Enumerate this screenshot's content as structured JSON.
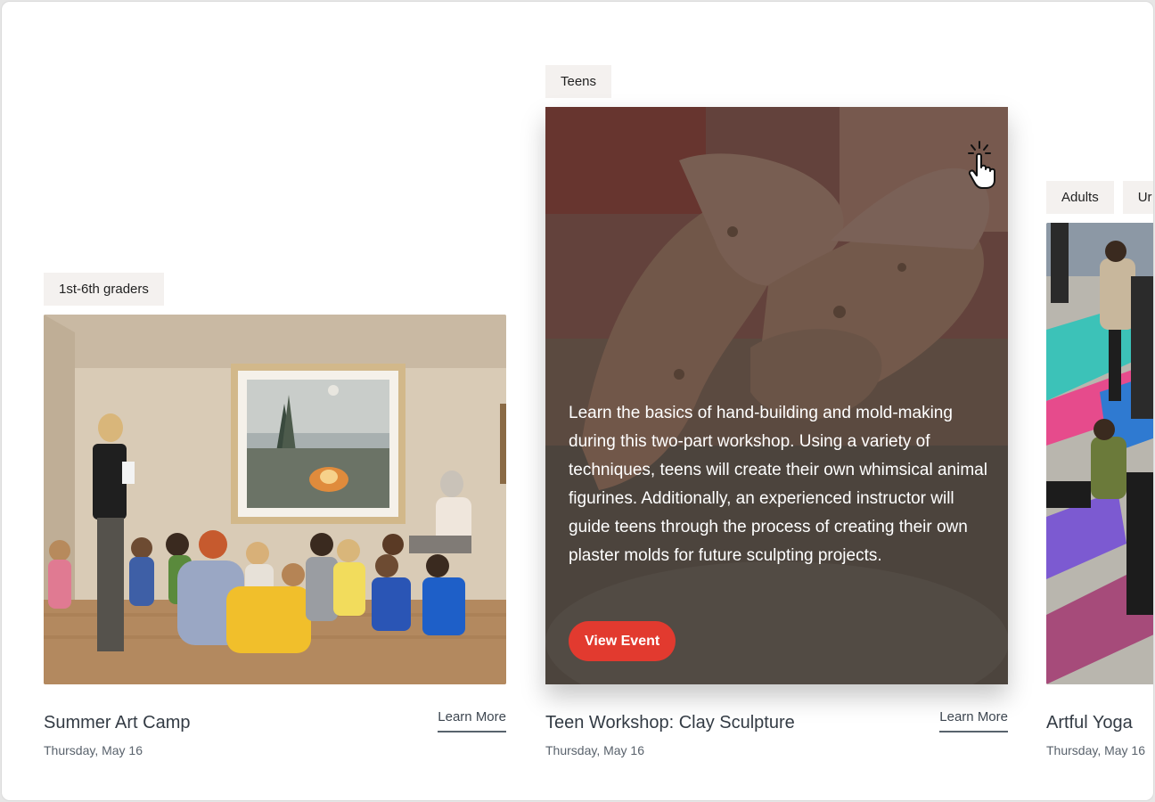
{
  "events": [
    {
      "tags": [
        "1st-6th graders"
      ],
      "title": "Summer Art Camp",
      "date": "Thursday, May 16",
      "link_label": "Learn More",
      "image_icon": "gallery-photo"
    },
    {
      "tags": [
        "Teens"
      ],
      "title": "Teen Workshop: Clay Sculpture",
      "date": "Thursday, May 16",
      "link_label": "Learn More",
      "description": "Learn the basics of hand-building and mold-making during this two-part workshop. Using a variety of techniques, teens will create their own whimsical animal figurines. Additionally, an experienced instructor will guide teens through the process of creating their own plaster molds for future sculpting projects.",
      "cta_label": "View Event",
      "image_icon": "clay-hands-photo"
    },
    {
      "tags": [
        "Adults",
        "Ur"
      ],
      "title": "Artful Yoga",
      "date": "Thursday, May 16",
      "image_icon": "yoga-photo"
    }
  ],
  "colors": {
    "accent": "#e23a2f",
    "tag_bg": "#f4f1ef",
    "title_text": "#333b44",
    "meta_text": "#59626c"
  }
}
